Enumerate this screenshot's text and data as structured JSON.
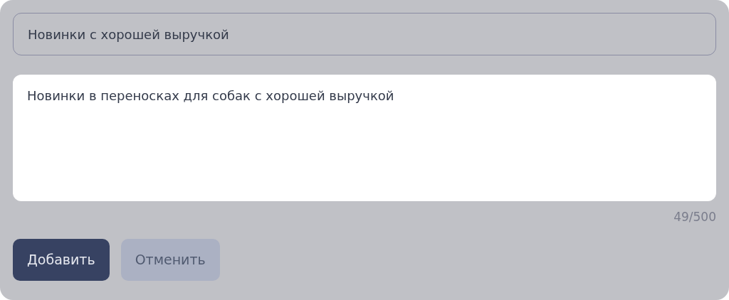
{
  "title_field": {
    "value": "Новинки с хорошей выручкой"
  },
  "description_field": {
    "value": "Новинки в переносках для собак с хорошей выручкой",
    "counter": "49/500"
  },
  "buttons": [
    {
      "label": "Добавить",
      "kind": "primary"
    },
    {
      "label": "Отменить",
      "kind": "secondary"
    }
  ]
}
